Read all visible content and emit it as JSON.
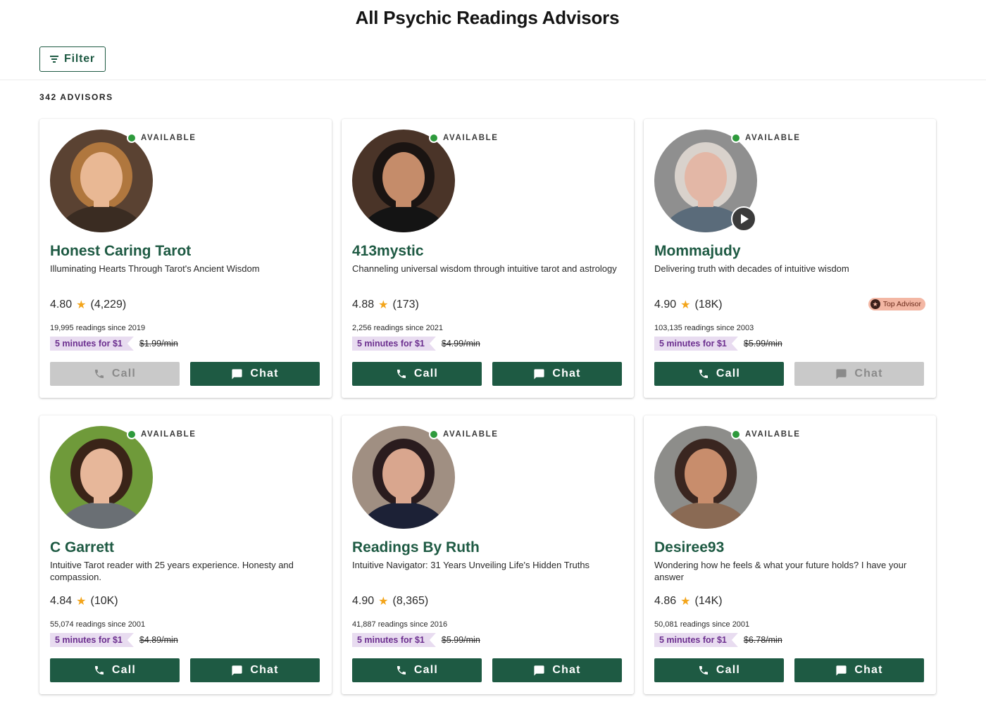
{
  "page": {
    "title": "All Psychic Readings Advisors",
    "filter_label": "Filter",
    "count_label": "342 ADVISORS"
  },
  "colors": {
    "brand_green": "#1e5a43",
    "available_dot": "#2e9a3c",
    "promo_bg": "#e8dcf0",
    "promo_text": "#6c2f8f",
    "disabled_button": "#c9c9c9",
    "star": "#f3a51b",
    "top_advisor_badge": "#f3b7a4"
  },
  "advisors": [
    {
      "name": "Honest Caring Tarot",
      "tagline": "Illuminating Hearts Through Tarot's Ancient Wisdom",
      "status": "AVAILABLE",
      "rating": "4.80",
      "reviews": "(4,229)",
      "readings": "19,995 readings since 2019",
      "promo": "5 minutes for $1",
      "old_price": "$1.99/min",
      "call_label": "Call",
      "chat_label": "Chat",
      "call_enabled": false,
      "chat_enabled": true,
      "has_video": false,
      "top_advisor": "",
      "avatar": {
        "bg": "#5a4232",
        "skin": "#e9b894",
        "hair": "#b0773e",
        "top": "#3a2c22"
      }
    },
    {
      "name": "413mystic",
      "tagline": "Channeling universal wisdom through intuitive tarot and astrology",
      "status": "AVAILABLE",
      "rating": "4.88",
      "reviews": "(173)",
      "readings": "2,256 readings since 2021",
      "promo": "5 minutes for $1",
      "old_price": "$4.99/min",
      "call_label": "Call",
      "chat_label": "Chat",
      "call_enabled": true,
      "chat_enabled": true,
      "has_video": false,
      "top_advisor": "",
      "avatar": {
        "bg": "#4a3428",
        "skin": "#c58c6a",
        "hair": "#1a1412",
        "top": "#141414"
      }
    },
    {
      "name": "Mommajudy",
      "tagline": "Delivering truth with decades of intuitive wisdom",
      "status": "AVAILABLE",
      "rating": "4.90",
      "reviews": "(18K)",
      "readings": "103,135 readings since 2003",
      "promo": "5 minutes for $1",
      "old_price": "$5.99/min",
      "call_label": "Call",
      "chat_label": "Chat",
      "call_enabled": true,
      "chat_enabled": false,
      "has_video": true,
      "top_advisor": "Top Advisor",
      "avatar": {
        "bg": "#8f8f8f",
        "skin": "#e3b7a6",
        "hair": "#d9d2cc",
        "top": "#5a6b7a"
      }
    },
    {
      "name": "C Garrett",
      "tagline": "Intuitive Tarot reader with 25 years experience. Honesty and compassion.",
      "status": "AVAILABLE",
      "rating": "4.84",
      "reviews": "(10K)",
      "readings": "55,074 readings since 2001",
      "promo": "5 minutes for $1",
      "old_price": "$4.89/min",
      "call_label": "Call",
      "chat_label": "Chat",
      "call_enabled": true,
      "chat_enabled": true,
      "has_video": false,
      "top_advisor": "",
      "avatar": {
        "bg": "#6f9a3a",
        "skin": "#e7b79a",
        "hair": "#3a2418",
        "top": "#6a6f74"
      }
    },
    {
      "name": "Readings By Ruth",
      "tagline": "Intuitive Navigator: 31 Years Unveiling Life's Hidden Truths",
      "status": "AVAILABLE",
      "rating": "4.90",
      "reviews": "(8,365)",
      "readings": "41,887 readings since 2016",
      "promo": "5 minutes for $1",
      "old_price": "$5.99/min",
      "call_label": "Call",
      "chat_label": "Chat",
      "call_enabled": true,
      "chat_enabled": true,
      "has_video": false,
      "top_advisor": "",
      "avatar": {
        "bg": "#a08f82",
        "skin": "#d9a68e",
        "hair": "#2a1c1e",
        "top": "#1c2136"
      }
    },
    {
      "name": "Desiree93",
      "tagline": "Wondering how he feels & what your future holds? I have your answer",
      "status": "AVAILABLE",
      "rating": "4.86",
      "reviews": "(14K)",
      "readings": "50,081 readings since 2001",
      "promo": "5 minutes for $1",
      "old_price": "$6.78/min",
      "call_label": "Call",
      "chat_label": "Chat",
      "call_enabled": true,
      "chat_enabled": true,
      "has_video": false,
      "top_advisor": "",
      "avatar": {
        "bg": "#8d8d8a",
        "skin": "#c88d6c",
        "hair": "#3a2620",
        "top": "#8a6a54"
      }
    }
  ]
}
